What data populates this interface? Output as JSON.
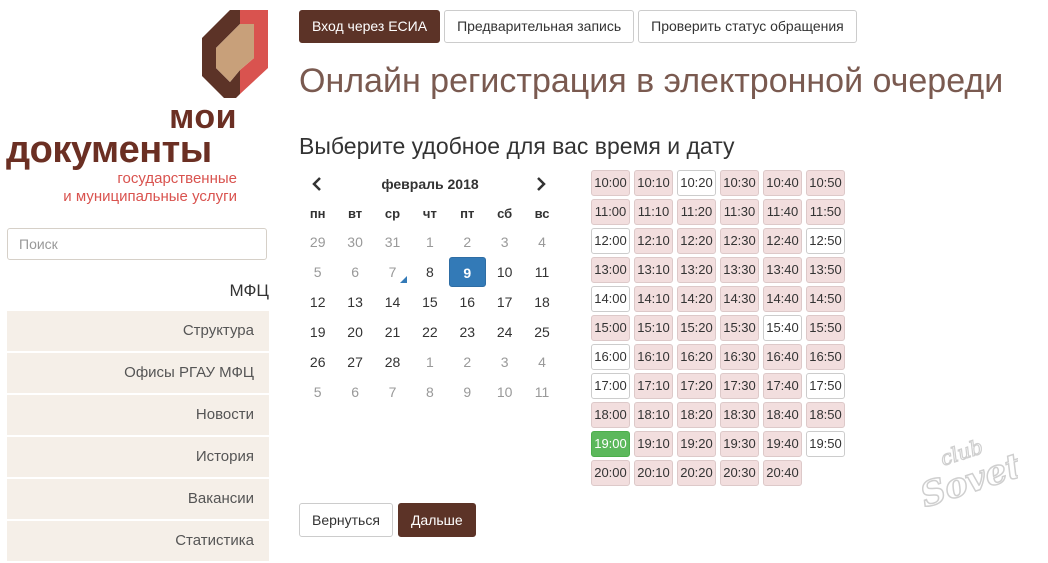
{
  "brand": {
    "title_line1": "мои",
    "title_line2": "документы",
    "subtitle_line1": "государственные",
    "subtitle_line2": "и муниципальные услуги"
  },
  "search": {
    "placeholder": "Поиск"
  },
  "sidebar": {
    "heading": "МФЦ",
    "items": [
      {
        "label": "Структура"
      },
      {
        "label": "Офисы РГАУ МФЦ"
      },
      {
        "label": "Новости"
      },
      {
        "label": "История"
      },
      {
        "label": "Вакансии"
      },
      {
        "label": "Статистика"
      }
    ]
  },
  "topnav": {
    "esia": "Вход через ЕСИА",
    "prebook": "Предварительная запись",
    "status": "Проверить статус обращения"
  },
  "page": {
    "title": "Онлайн регистрация в электронной очереди",
    "subtitle": "Выберите удобное для вас время и дату"
  },
  "calendar": {
    "month": "февраль 2018",
    "weekdays": [
      "пн",
      "вт",
      "ср",
      "чт",
      "пт",
      "сб",
      "вс"
    ],
    "days": [
      {
        "d": "29",
        "muted": true
      },
      {
        "d": "30",
        "muted": true
      },
      {
        "d": "31",
        "muted": true
      },
      {
        "d": "1",
        "muted": true
      },
      {
        "d": "2",
        "muted": true
      },
      {
        "d": "3",
        "muted": true
      },
      {
        "d": "4",
        "muted": true
      },
      {
        "d": "5",
        "muted": true
      },
      {
        "d": "6",
        "muted": true
      },
      {
        "d": "7",
        "muted": true,
        "today": true
      },
      {
        "d": "8"
      },
      {
        "d": "9",
        "active": true
      },
      {
        "d": "10"
      },
      {
        "d": "11"
      },
      {
        "d": "12"
      },
      {
        "d": "13"
      },
      {
        "d": "14"
      },
      {
        "d": "15"
      },
      {
        "d": "16"
      },
      {
        "d": "17"
      },
      {
        "d": "18"
      },
      {
        "d": "19"
      },
      {
        "d": "20"
      },
      {
        "d": "21"
      },
      {
        "d": "22"
      },
      {
        "d": "23"
      },
      {
        "d": "24"
      },
      {
        "d": "25"
      },
      {
        "d": "26"
      },
      {
        "d": "27"
      },
      {
        "d": "28"
      },
      {
        "d": "1",
        "muted": true
      },
      {
        "d": "2",
        "muted": true
      },
      {
        "d": "3",
        "muted": true
      },
      {
        "d": "4",
        "muted": true
      },
      {
        "d": "5",
        "muted": true
      },
      {
        "d": "6",
        "muted": true
      },
      {
        "d": "7",
        "muted": true
      },
      {
        "d": "8",
        "muted": true
      },
      {
        "d": "9",
        "muted": true
      },
      {
        "d": "10",
        "muted": true
      },
      {
        "d": "11",
        "muted": true
      }
    ]
  },
  "slots": [
    {
      "t": "10:00",
      "s": "busy"
    },
    {
      "t": "10:10",
      "s": "busy"
    },
    {
      "t": "10:20",
      "s": "free"
    },
    {
      "t": "10:30",
      "s": "busy"
    },
    {
      "t": "10:40",
      "s": "busy"
    },
    {
      "t": "10:50",
      "s": "busy"
    },
    {
      "t": "11:00",
      "s": "busy"
    },
    {
      "t": "11:10",
      "s": "busy"
    },
    {
      "t": "11:20",
      "s": "busy"
    },
    {
      "t": "11:30",
      "s": "busy"
    },
    {
      "t": "11:40",
      "s": "busy"
    },
    {
      "t": "11:50",
      "s": "busy"
    },
    {
      "t": "12:00",
      "s": "free"
    },
    {
      "t": "12:10",
      "s": "busy"
    },
    {
      "t": "12:20",
      "s": "busy"
    },
    {
      "t": "12:30",
      "s": "busy"
    },
    {
      "t": "12:40",
      "s": "busy"
    },
    {
      "t": "12:50",
      "s": "free"
    },
    {
      "t": "13:00",
      "s": "busy"
    },
    {
      "t": "13:10",
      "s": "busy"
    },
    {
      "t": "13:20",
      "s": "busy"
    },
    {
      "t": "13:30",
      "s": "busy"
    },
    {
      "t": "13:40",
      "s": "busy"
    },
    {
      "t": "13:50",
      "s": "busy"
    },
    {
      "t": "14:00",
      "s": "free"
    },
    {
      "t": "14:10",
      "s": "busy"
    },
    {
      "t": "14:20",
      "s": "busy"
    },
    {
      "t": "14:30",
      "s": "busy"
    },
    {
      "t": "14:40",
      "s": "busy"
    },
    {
      "t": "14:50",
      "s": "busy"
    },
    {
      "t": "15:00",
      "s": "busy"
    },
    {
      "t": "15:10",
      "s": "busy"
    },
    {
      "t": "15:20",
      "s": "busy"
    },
    {
      "t": "15:30",
      "s": "busy"
    },
    {
      "t": "15:40",
      "s": "free"
    },
    {
      "t": "15:50",
      "s": "busy"
    },
    {
      "t": "16:00",
      "s": "free"
    },
    {
      "t": "16:10",
      "s": "busy"
    },
    {
      "t": "16:20",
      "s": "busy"
    },
    {
      "t": "16:30",
      "s": "busy"
    },
    {
      "t": "16:40",
      "s": "busy"
    },
    {
      "t": "16:50",
      "s": "busy"
    },
    {
      "t": "17:00",
      "s": "free"
    },
    {
      "t": "17:10",
      "s": "busy"
    },
    {
      "t": "17:20",
      "s": "busy"
    },
    {
      "t": "17:30",
      "s": "busy"
    },
    {
      "t": "17:40",
      "s": "busy"
    },
    {
      "t": "17:50",
      "s": "free"
    },
    {
      "t": "18:00",
      "s": "busy"
    },
    {
      "t": "18:10",
      "s": "busy"
    },
    {
      "t": "18:20",
      "s": "busy"
    },
    {
      "t": "18:30",
      "s": "busy"
    },
    {
      "t": "18:40",
      "s": "busy"
    },
    {
      "t": "18:50",
      "s": "busy"
    },
    {
      "t": "19:00",
      "s": "selected"
    },
    {
      "t": "19:10",
      "s": "busy"
    },
    {
      "t": "19:20",
      "s": "busy"
    },
    {
      "t": "19:30",
      "s": "busy"
    },
    {
      "t": "19:40",
      "s": "busy"
    },
    {
      "t": "19:50",
      "s": "free"
    },
    {
      "t": "20:00",
      "s": "busy"
    },
    {
      "t": "20:10",
      "s": "busy"
    },
    {
      "t": "20:20",
      "s": "busy"
    },
    {
      "t": "20:30",
      "s": "busy"
    },
    {
      "t": "20:40",
      "s": "busy"
    }
  ],
  "actions": {
    "back": "Вернуться",
    "next": "Дальше"
  },
  "watermark": {
    "text": "club Sovet"
  },
  "colors": {
    "brand_dark": "#5c3327",
    "busy_slot": "#f2dede",
    "selected_slot": "#5cb85c",
    "active_day": "#337ab7"
  }
}
